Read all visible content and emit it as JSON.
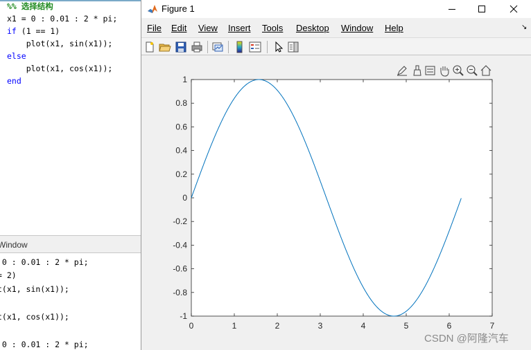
{
  "editor": {
    "lines": [
      "%% 选择结构",
      "x1 = 0 : 0.01 : 2 * pi;",
      "if (1 == 1)",
      "    plot(x1, sin(x1));",
      "else",
      "    plot(x1, cos(x1));",
      "end"
    ]
  },
  "command_window": {
    "title": "Window",
    "lines": [
      " 0 : 0.01 : 2 * pi;",
      "= 2)",
      "t(x1, sin(x1));",
      "",
      "t(x1, cos(x1));",
      "",
      " 0 : 0.01 : 2 * pi;"
    ]
  },
  "figure": {
    "title": "Figure 1",
    "menu": [
      "File",
      "Edit",
      "View",
      "Insert",
      "Tools",
      "Desktop",
      "Window",
      "Help"
    ],
    "toolbar_icons": [
      "new-figure-icon",
      "open-file-icon",
      "save-icon",
      "print-icon",
      "link-plot-icon",
      "colorbar-icon",
      "legend-icon",
      "pointer-icon",
      "property-inspector-icon"
    ],
    "axes_toolbar_icons": [
      "edit-plot-icon",
      "brush-icon",
      "data-tips-icon",
      "pan-icon",
      "zoom-in-icon",
      "zoom-out-icon",
      "home-icon"
    ]
  },
  "chart_data": {
    "type": "line",
    "title": "",
    "xlabel": "",
    "ylabel": "",
    "xlim": [
      0,
      7
    ],
    "ylim": [
      -1,
      1
    ],
    "xticks": [
      "0",
      "1",
      "2",
      "3",
      "4",
      "5",
      "6",
      "7"
    ],
    "yticks": [
      "-1",
      "-0.8",
      "-0.6",
      "-0.4",
      "-0.2",
      "0",
      "0.2",
      "0.4",
      "0.6",
      "0.8",
      "1"
    ],
    "grid": false,
    "line_color": "#0072bd",
    "series": [
      {
        "function": "sin",
        "x_start": 0,
        "x_step": 0.01,
        "x_end": 6.28,
        "sample_points": [
          {
            "x": 0,
            "y": 0
          },
          {
            "x": 1.57,
            "y": 1
          },
          {
            "x": 3.14,
            "y": 0
          },
          {
            "x": 4.71,
            "y": -1
          },
          {
            "x": 6.28,
            "y": 0
          }
        ]
      }
    ]
  },
  "watermark": "CSDN @阿隆汽车"
}
